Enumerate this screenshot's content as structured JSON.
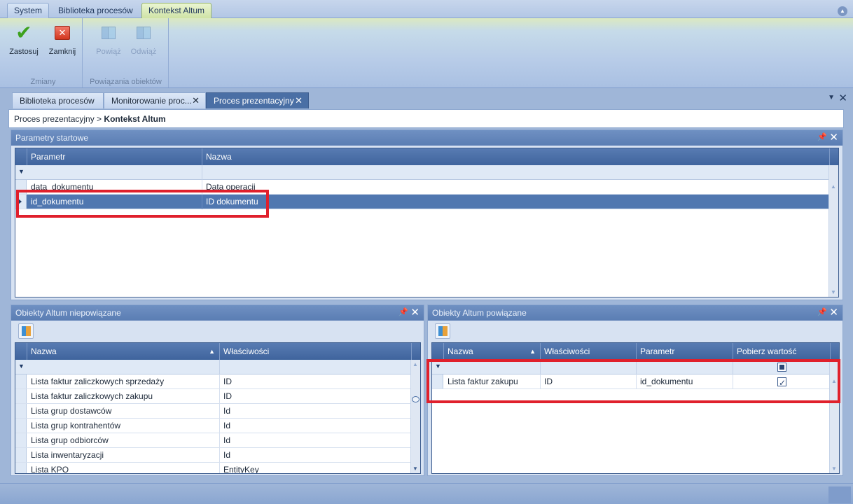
{
  "ribbon": {
    "tabs": [
      "System",
      "Biblioteka procesów",
      "Kontekst Altum"
    ],
    "groups": {
      "changes": {
        "label": "Zmiany",
        "apply": "Zastosuj",
        "close": "Zamknij"
      },
      "links": {
        "label": "Powiązania obiektów",
        "link": "Powiąż",
        "unlink": "Odwiąż"
      }
    }
  },
  "document_tabs": [
    {
      "label": "Biblioteka procesów"
    },
    {
      "label": "Monitorowanie proc..."
    },
    {
      "label": "Proces prezentacyjny"
    }
  ],
  "breadcrumb": {
    "path": "Proces prezentacyjny >",
    "current": "Kontekst Altum"
  },
  "start_params": {
    "title": "Parametry startowe",
    "columns": [
      "Parametr",
      "Nazwa"
    ],
    "rows": [
      {
        "param": "data_dokumentu",
        "name": "Data operacji"
      },
      {
        "param": "id_dokumentu",
        "name": "ID dokumentu"
      }
    ]
  },
  "unlinked": {
    "title": "Obiekty Altum niepowiązane",
    "columns": [
      "Nazwa",
      "Właściwości"
    ],
    "rows": [
      {
        "name": "Lista faktur zaliczkowych sprzedaży",
        "prop": "ID"
      },
      {
        "name": "Lista faktur zaliczkowych zakupu",
        "prop": "ID"
      },
      {
        "name": "Lista grup dostawców",
        "prop": "Id"
      },
      {
        "name": "Lista grup kontrahentów",
        "prop": "Id"
      },
      {
        "name": "Lista grup odbiorców",
        "prop": "Id"
      },
      {
        "name": "Lista inwentaryzacji",
        "prop": "Id"
      },
      {
        "name": "Lista KPO",
        "prop": "EntityKey"
      }
    ]
  },
  "linked": {
    "title": "Obiekty Altum powiązane",
    "columns": [
      "Nazwa",
      "Właściwości",
      "Parametr",
      "Pobierz wartość"
    ],
    "rows": [
      {
        "name": "Lista faktur zakupu",
        "prop": "ID",
        "param": "id_dokumentu",
        "fetch": true
      }
    ]
  },
  "colors": {
    "accent": "#4a6fa5",
    "highlight": "#e0202c",
    "ribbon_active": "#cfe3a6"
  }
}
